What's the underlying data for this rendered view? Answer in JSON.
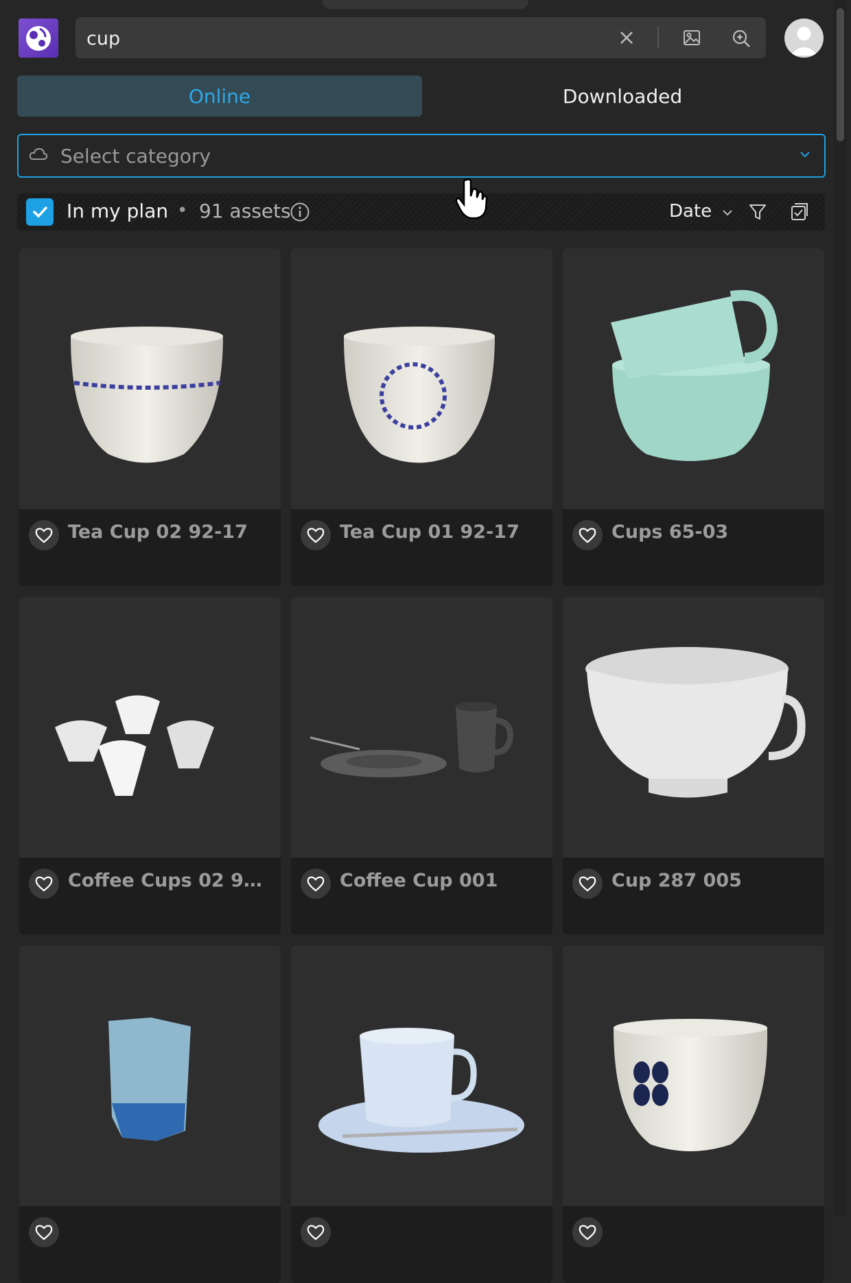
{
  "search": {
    "value": "cup",
    "clear_icon": "close-icon",
    "image_search_icon": "image-icon",
    "ai_search_icon": "sparkle-search-icon"
  },
  "tabs": [
    {
      "label": "Online",
      "active": true
    },
    {
      "label": "Downloaded",
      "active": false
    }
  ],
  "category": {
    "placeholder": "Select category",
    "icon": "cloud-icon"
  },
  "plan_bar": {
    "checked": true,
    "label": "In my plan",
    "separator": "•",
    "asset_count": "91 assets",
    "sort_label": "Date"
  },
  "colors": {
    "accent": "#1ea0e4",
    "logo": "#7e4fd1",
    "tab_active_bg": "#344b55"
  },
  "assets": [
    {
      "title": "Tea Cup 02 92-17"
    },
    {
      "title": "Tea Cup 01 92-17"
    },
    {
      "title": "Cups 65-03"
    },
    {
      "title": "Coffee Cups 02 92-..."
    },
    {
      "title": "Coffee Cup 001"
    },
    {
      "title": "Cup 287 005"
    },
    {
      "title": ""
    },
    {
      "title": ""
    },
    {
      "title": ""
    }
  ]
}
